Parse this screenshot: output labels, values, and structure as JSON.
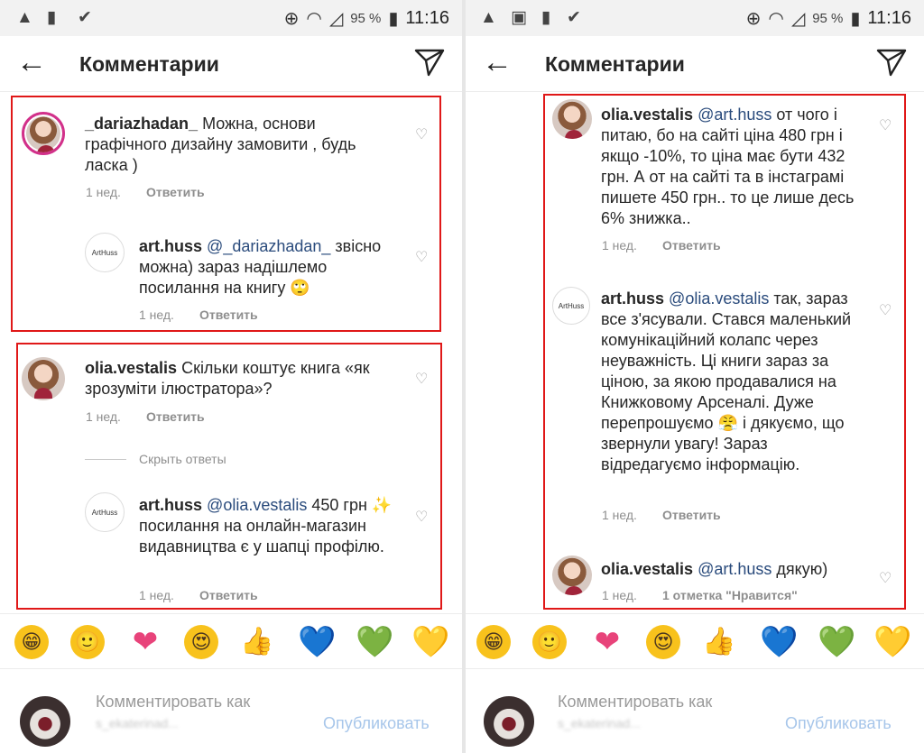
{
  "status": {
    "battery": "95 %",
    "time": "11:16"
  },
  "header": {
    "title": "Комментарии"
  },
  "left": {
    "c1": {
      "user": "_dariazhadan_",
      "text": " Можна, основи графічного дизайну замовити , будь ласка )",
      "time": "1 нед.",
      "reply": "Ответить"
    },
    "r1": {
      "user": "art.huss",
      "mention": "@_dariazhadan_",
      "text": " звісно можна) зараз надішлемо посилання на книгу 🙄",
      "time": "1 нед.",
      "reply": "Ответить"
    },
    "c2": {
      "user": "olia.vestalis",
      "text": " Скільки коштує книга «як зрозуміти ілюстратора»?",
      "time": "1 нед.",
      "reply": "Ответить"
    },
    "hide_replies": "Скрыть ответы",
    "r2": {
      "user": "art.huss",
      "mention": "@olia.vestalis",
      "text": " 450 грн ✨ посилання на онлайн-магазин видавництва є у шапці профілю.",
      "time": "1 нед.",
      "reply": "Ответить"
    }
  },
  "right": {
    "c1": {
      "user": "olia.vestalis",
      "mention": "@art.huss",
      "text": " от чого і питаю, бо на сайті ціна 480 грн і якщо -10%, то ціна має бути 432 грн. А от на сайті та в інстаграмі пишете 450 грн.. то це лише десь 6% знижка..",
      "time": "1 нед.",
      "reply": "Ответить"
    },
    "c2": {
      "user": "art.huss",
      "mention": "@olia.vestalis",
      "text": " так, зараз все з'ясували. Стався маленький комунікаційний колапс через неуважність. Ці книги зараз за ціною, за якою продавалися на Книжковому Арсеналі. Дуже перепрошуємо 😤 і дякуємо, що звернули увагу! Зараз відредагуємо інформацію.",
      "time": "1 нед.",
      "reply": "Ответить"
    },
    "c3": {
      "user": "olia.vestalis",
      "mention": "@art.huss",
      "text": " дякую)",
      "time": "1 нед.",
      "likes": "1 отметка \"Нравится\""
    }
  },
  "avatar_text": "ArtHuss",
  "emojis": [
    "😁",
    "🙂",
    "❤",
    "😍",
    "👍",
    "💙",
    "💚",
    "💛"
  ],
  "composer": {
    "placeholder": "Комментировать как",
    "username": "s_ekaterinad...",
    "publish": "Опубликовать"
  },
  "icons": {
    "back": "arrow-left-icon",
    "send": "paper-plane-icon",
    "like": "heart-outline-icon"
  },
  "colors": {
    "highlight_border": "#e01818",
    "mention": "#2a4b7c",
    "publish": "#a7c6ea"
  }
}
